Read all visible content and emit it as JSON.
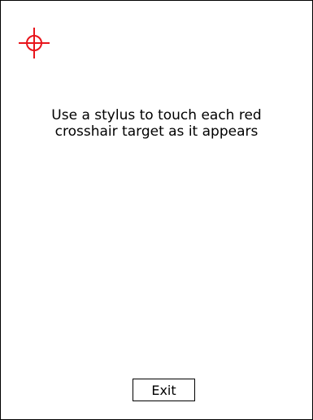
{
  "instructions": {
    "line1": "Use a stylus to touch each red",
    "line2": "crosshair target as it appears"
  },
  "exit_button": {
    "label": "Exit"
  },
  "colors": {
    "crosshair": "#e8141b",
    "text": "#000000",
    "background": "#ffffff",
    "border": "#000000"
  },
  "icons": {
    "target": "crosshair-target-icon"
  }
}
